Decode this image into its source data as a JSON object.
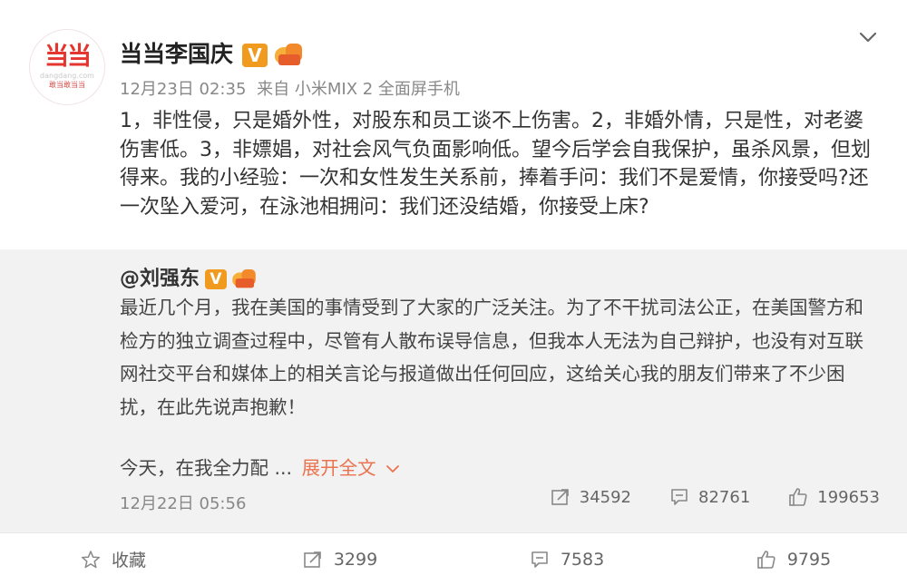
{
  "post": {
    "avatar": {
      "logo": "当当",
      "domain": "dangdang.com",
      "slogan": "敢当敢当当"
    },
    "username": "当当李国庆",
    "verified_badge": "V",
    "timestamp": "12月23日 02:35",
    "source": "来自 小米MIX 2 全面屏手机",
    "content": "1，非性侵，只是婚外性，对股东和员工谈不上伤害。2，非婚外情，只是性，对老婆伤害低。3，非嫖娼，对社会风气负面影响低。望今后学会自我保护，虽杀风景，但划得来。我的小经验：一次和女性发生关系前，捧着手问：我们不是爱情，你接受吗?还一次坠入爱河，在泳池相拥问：我们还没结婚，你接受上床?"
  },
  "repost": {
    "username": "@刘强东",
    "verified_badge": "V",
    "content": "最近几个月，我在美国的事情受到了大家的广泛关注。为了不干扰司法公正，在美国警方和检方的独立调查过程中，尽管有人散布误导信息，但我本人无法为自己辩护，也没有对互联网社交平台和媒体上的相关言论与报道做出任何回应，这给关心我的朋友们带来了不少困扰，在此先说声抱歉！",
    "content_truncated": "今天，在我全力配 ...",
    "expand_label": "展开全文",
    "date": "12月22日 05:56",
    "stats": {
      "reposts": "34592",
      "comments": "82761",
      "likes": "199653"
    }
  },
  "footer": {
    "favorite_label": "收藏",
    "reposts": "3299",
    "comments": "7583",
    "likes": "9795"
  },
  "colors": {
    "accent": "#eb7350",
    "verified": "#f09a1f",
    "brand": "#e3362f"
  }
}
